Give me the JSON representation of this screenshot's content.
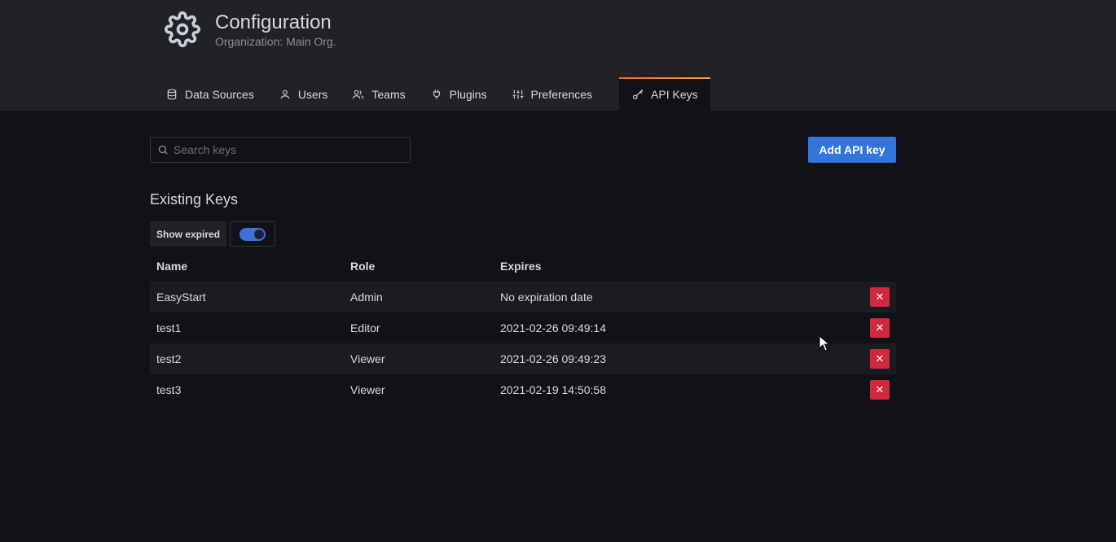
{
  "header": {
    "title": "Configuration",
    "subtitle": "Organization: Main Org.",
    "icon": "gear-icon"
  },
  "tabs": [
    {
      "label": "Data Sources",
      "icon": "database-icon",
      "active": false
    },
    {
      "label": "Users",
      "icon": "user-icon",
      "active": false
    },
    {
      "label": "Teams",
      "icon": "users-icon",
      "active": false
    },
    {
      "label": "Plugins",
      "icon": "plug-icon",
      "active": false
    },
    {
      "label": "Preferences",
      "icon": "sliders-icon",
      "active": false
    },
    {
      "label": "API Keys",
      "icon": "key-icon",
      "active": true
    }
  ],
  "search": {
    "placeholder": "Search keys",
    "value": ""
  },
  "add_button_label": "Add API key",
  "section_title": "Existing Keys",
  "show_expired": {
    "label": "Show expired",
    "enabled": true
  },
  "table": {
    "columns": [
      "Name",
      "Role",
      "Expires"
    ],
    "rows": [
      {
        "name": "EasyStart",
        "role": "Admin",
        "expires": "No expiration date"
      },
      {
        "name": "test1",
        "role": "Editor",
        "expires": "2021-02-26 09:49:14"
      },
      {
        "name": "test2",
        "role": "Viewer",
        "expires": "2021-02-26 09:49:23"
      },
      {
        "name": "test3",
        "role": "Viewer",
        "expires": "2021-02-19 14:50:58"
      }
    ],
    "delete_glyph": "✕"
  },
  "colors": {
    "accent": "#3274d9",
    "danger": "#d1283a",
    "active_tab_gradient": [
      "#ff6630",
      "#f2a23a"
    ]
  }
}
